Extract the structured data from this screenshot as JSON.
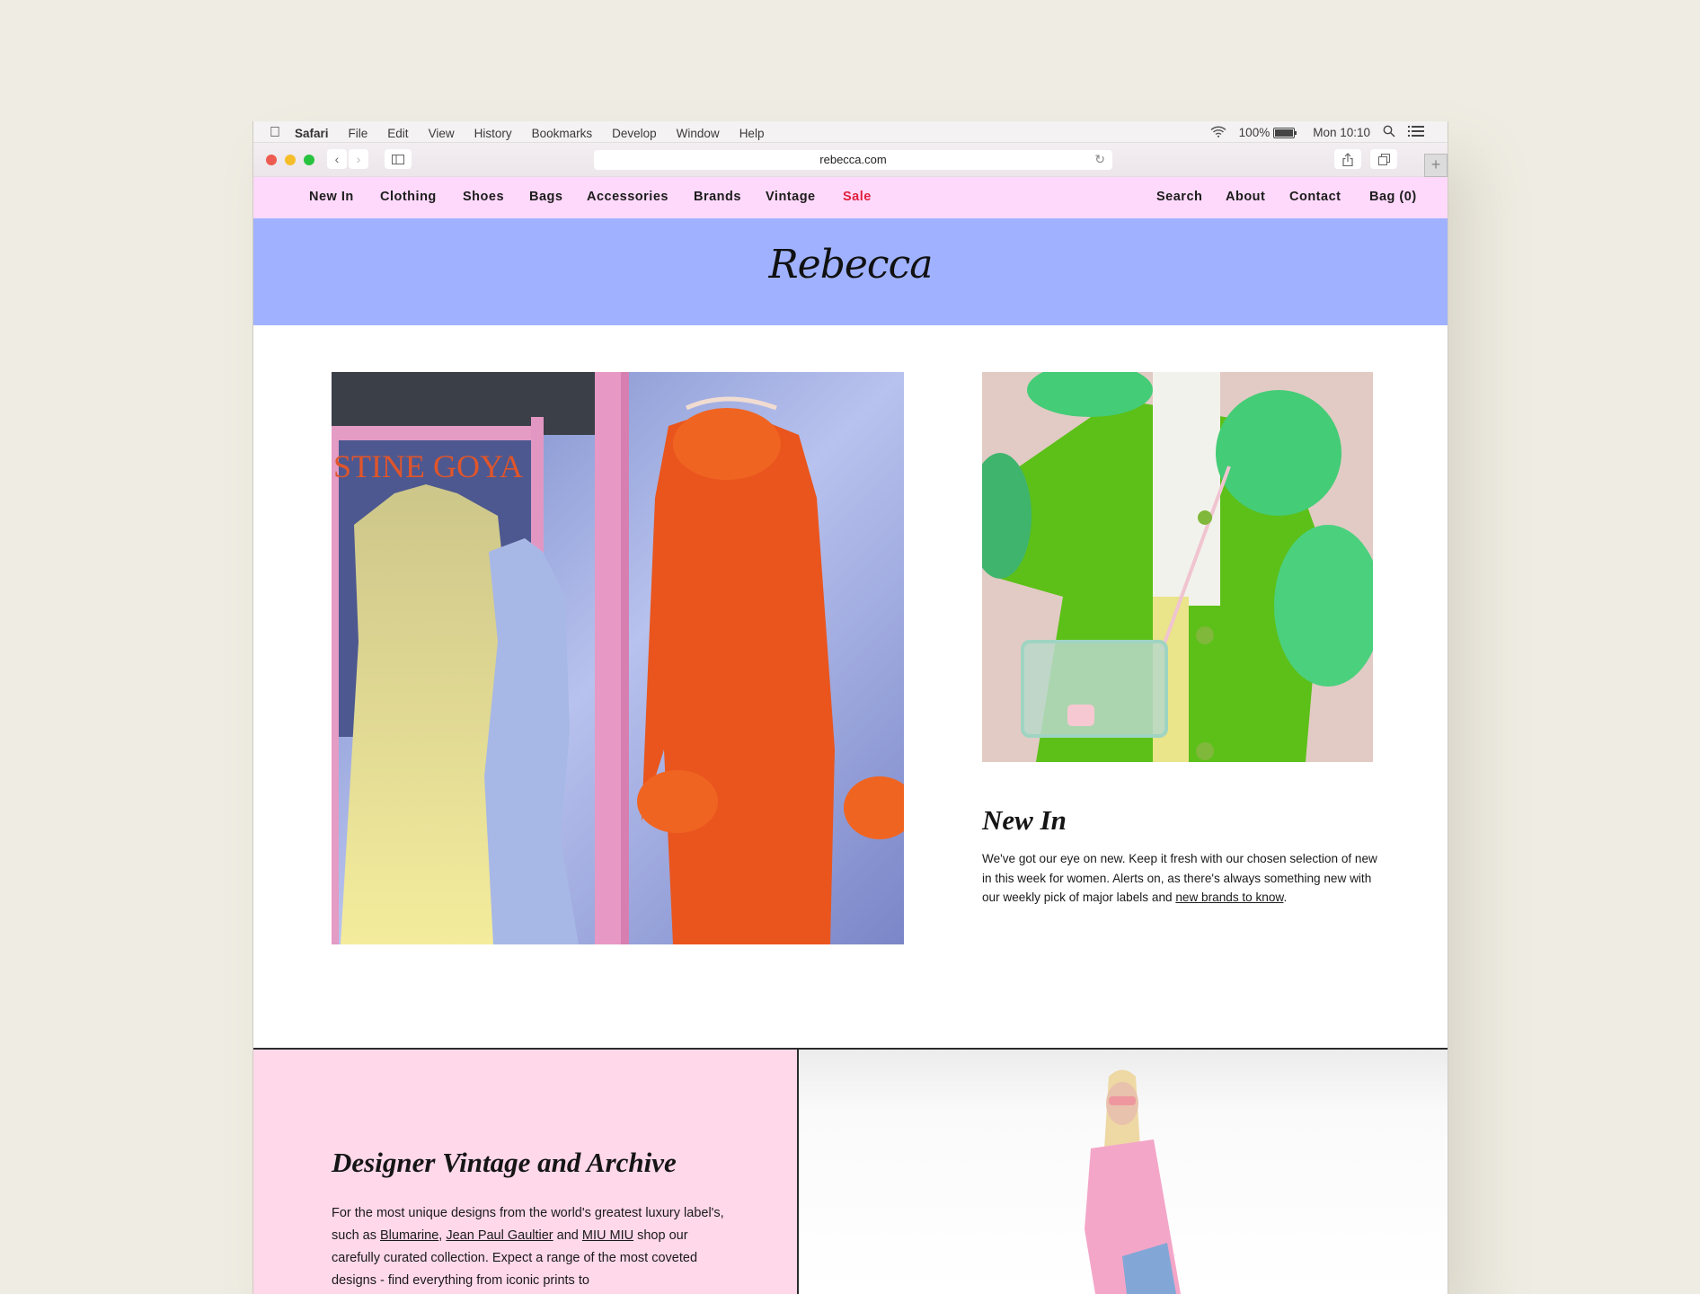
{
  "menubar": {
    "app": "Safari",
    "items": [
      "File",
      "Edit",
      "View",
      "History",
      "Bookmarks",
      "Develop",
      "Window",
      "Help"
    ],
    "battery": "100%",
    "clock": "Mon 10:10"
  },
  "toolbar": {
    "url": "rebecca.com"
  },
  "nav": {
    "left": [
      "New In",
      "Clothing",
      "Shoes",
      "Bags",
      "Accessories",
      "Brands",
      "Vintage",
      "Sale"
    ],
    "right": [
      "Search",
      "About",
      "Contact",
      "Bag (0)"
    ],
    "sale_color": "#e01f3d"
  },
  "hero": {
    "logo": "Rebecca"
  },
  "new_in": {
    "title": "New In",
    "body": "We've got our eye on new. Keep it fresh with our chosen selection of new in this week for women. Alerts on, as there's always something new with our weekly pick of major labels and ",
    "link": "new brands to know",
    "end": "."
  },
  "vintage": {
    "title": "Designer Vintage and Archive",
    "body_1": "For the most unique designs from the world's greatest luxury label's, such as ",
    "link_1": "Blumarine",
    "sep_1": ", ",
    "link_2": "Jean Paul Gaultier",
    "sep_2": " and ",
    "link_3": "MIU MIU",
    "body_2": " shop our carefully curated collection. Expect a range of the most coveted designs - find everything from iconic prints to"
  },
  "images": {
    "left_sign": "STINE GOYA"
  },
  "colors": {
    "nav_bg": "#ffd9fb",
    "hero_bg": "#a0b2ff",
    "vintage_bg": "#ffd8ea"
  }
}
